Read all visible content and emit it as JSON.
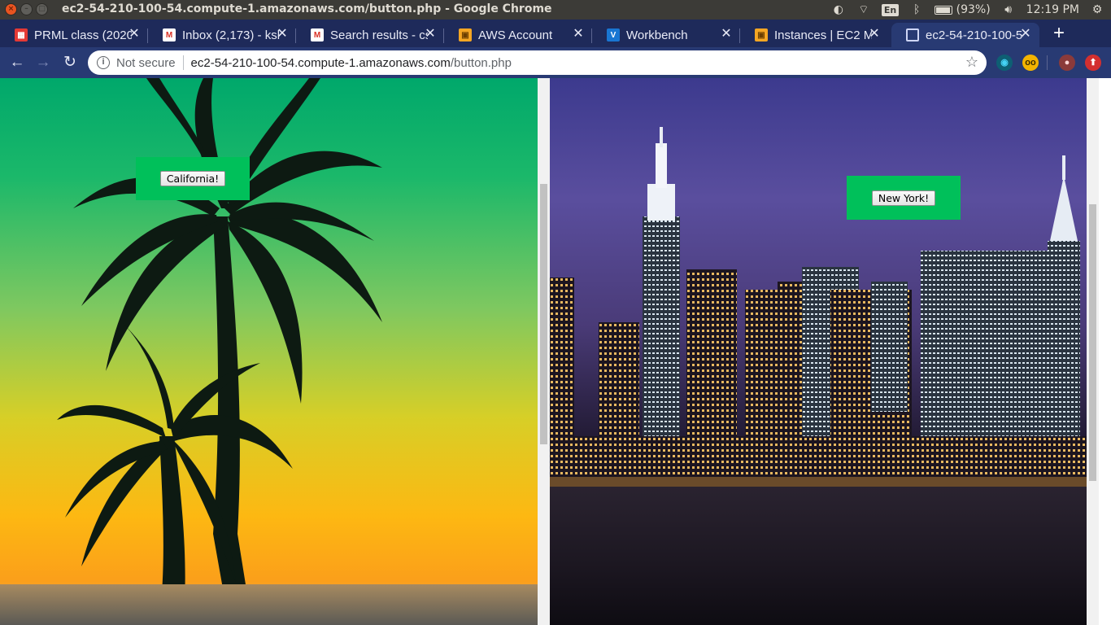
{
  "os_bar": {
    "window_title": "ec2-54-210-100-54.compute-1.amazonaws.com/button.php - Google Chrome",
    "language": "En",
    "battery": "(93%)",
    "clock": "12:19 PM"
  },
  "tabs": [
    {
      "label": "PRML class (2020",
      "favicon": "calendar-icon",
      "active": false
    },
    {
      "label": "Inbox (2,173) - ksl",
      "favicon": "gmail-icon",
      "active": false
    },
    {
      "label": "Search results - cs",
      "favicon": "gmail-icon",
      "active": false
    },
    {
      "label": "AWS Account",
      "favicon": "aws-icon",
      "active": false
    },
    {
      "label": "Workbench",
      "favicon": "vocareum-icon",
      "active": false
    },
    {
      "label": "Instances | EC2 M",
      "favicon": "aws-icon",
      "active": false
    },
    {
      "label": "ec2-54-210-100-54",
      "favicon": "globe-icon",
      "active": true
    }
  ],
  "omnibox": {
    "security_label": "Not secure",
    "url_host": "ec2-54-210-100-54.compute-1.amazonaws.com",
    "url_path": "/button.php"
  },
  "content": {
    "left_button_label": "California!",
    "right_button_label": "New York!"
  },
  "colors": {
    "panel_green": "#00c05a",
    "tab_strip": "#1e2a5a",
    "toolbar": "#283a73",
    "os_bar": "#3c3b37"
  }
}
